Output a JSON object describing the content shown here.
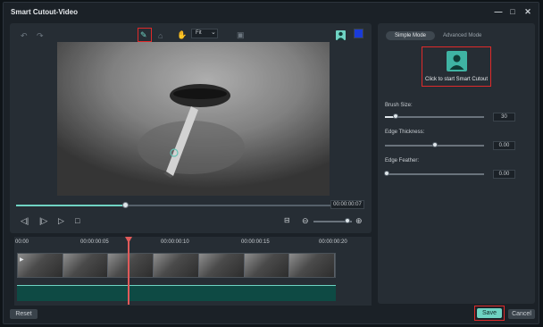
{
  "window": {
    "title": "Smart Cutout-Video",
    "minimize": "—",
    "maximize": "□",
    "close": "✕"
  },
  "toolbar": {
    "undo_icon": "undo-icon",
    "redo_icon": "redo-icon",
    "zoom_label": "Fit",
    "zoom_arrow": "⌄",
    "mark_color": "#6fd3c3",
    "bg_color": "#1a3bd8"
  },
  "player": {
    "timecode": "00:00:00:07",
    "progress_fraction": 0.35
  },
  "timeline": {
    "ruler": [
      "00:00",
      "00:00:00:05",
      "00:00:00:10",
      "00:00:00:15",
      "00:00:00:20"
    ]
  },
  "right": {
    "tabs": [
      "Simple Mode",
      "Advanced Mode"
    ],
    "start_label": "Click to start Smart Cutout",
    "brush_label": "Brush Size:",
    "brush_value": "30",
    "edge_thickness_label": "Edge Thickness:",
    "edge_thickness_value": "0.00",
    "edge_feather_label": "Edge Feather:",
    "edge_feather_value": "0.00"
  },
  "buttons": {
    "reset": "Reset",
    "save": "Save",
    "cancel": "Cancel"
  }
}
